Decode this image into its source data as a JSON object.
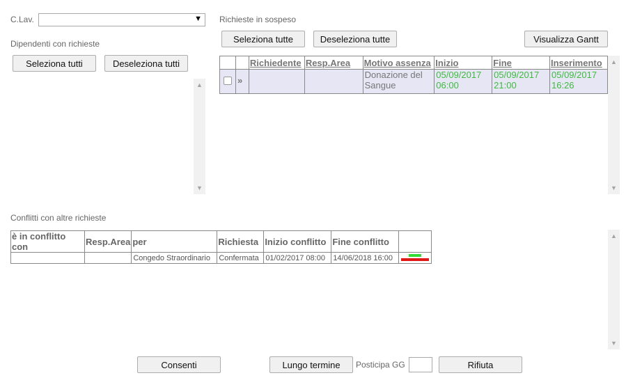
{
  "clav": {
    "label": "C.Lav.",
    "value": ""
  },
  "left_panel": {
    "title": "Dipendenti con richieste",
    "select_all": "Seleziona tutti",
    "deselect_all": "Deseleziona tutti"
  },
  "requests": {
    "title": "Richieste in sospeso",
    "select_all": "Seleziona tutte",
    "deselect_all": "Deseleziona tutte",
    "gantt": "Visualizza Gantt",
    "headers": [
      "Richiedente",
      "Resp.Area",
      "Motivo assenza",
      "Inizio",
      "Fine",
      "Inserimento"
    ],
    "rows": [
      {
        "richiedente": "",
        "resp_area": "",
        "motivo": "Donazione del Sangue",
        "inizio": "05/09/2017 06:00",
        "fine": "05/09/2017 21:00",
        "inserimento": "05/09/2017 16:26",
        "expand_icon": "double-chevron-right-icon"
      }
    ]
  },
  "conflicts": {
    "title": "Conflitti con altre richieste",
    "headers": [
      "è in conflitto con",
      "Resp.Area",
      "per",
      "Richiesta",
      "Inizio conflitto",
      "Fine conflitto",
      ""
    ],
    "rows": [
      {
        "con": "",
        "resp_area": "",
        "per": "Congedo Straordinario",
        "richiesta": "Confermata",
        "inizio": "01/02/2017 08:00",
        "fine": "14/06/2018 16:00"
      }
    ]
  },
  "footer": {
    "consenti": "Consenti",
    "lungo_termine": "Lungo termine",
    "posticipa_label": "Posticipa GG",
    "posticipa_value": "",
    "rifiuta": "Rifiuta"
  },
  "colors": {
    "green_text": "#3dbb3d",
    "red_text": "#d81d1d",
    "selected_row": "#e6e6f5"
  }
}
